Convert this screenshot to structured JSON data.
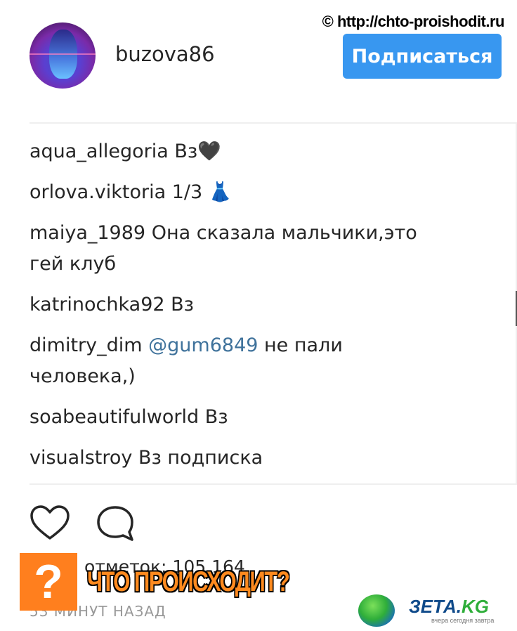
{
  "watermark": "© http://chto-proishodit.ru",
  "profile": {
    "username": "buzova86",
    "follow_label": "Подписаться"
  },
  "comments": [
    {
      "user": "aqua_allegoria",
      "text": "Вз",
      "emoji": "🖤"
    },
    {
      "user": "orlova.viktoria",
      "text": "1/3",
      "emoji": "👗"
    },
    {
      "user": "maiya_1989",
      "text": "Она сказала мальчики,это",
      "text2": "гей клуб"
    },
    {
      "user": "katrinochka92",
      "text": "Вз"
    },
    {
      "user": "dimitry_dim",
      "mention": "@gum6849",
      "text": "не пали",
      "text2": "человека,)"
    },
    {
      "user": "soabeautifulworld",
      "text": "Вз"
    },
    {
      "user": "visualstroy",
      "text": "Вз подписка"
    }
  ],
  "actions": {
    "like_icon": "heart-icon",
    "comment_icon": "comment-bubble-icon"
  },
  "likes": "отметок: 105 164",
  "time": "53 МИНУТ НАЗАД",
  "overlay": {
    "badge": "?",
    "caption": "ЧТО ПРОИСХОДИТ?"
  },
  "brand": {
    "name": "ЗЕТА.",
    "tld": "KG",
    "sub": "вчера сегодня завтра"
  },
  "colors": {
    "follow_button": "#3897f0",
    "mention": "#3f729b",
    "badge": "#ff7f1e"
  }
}
